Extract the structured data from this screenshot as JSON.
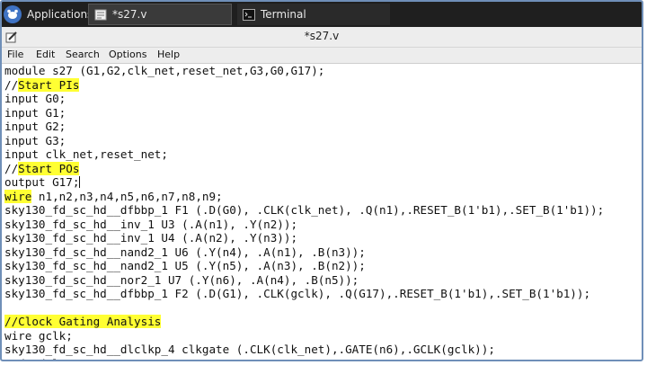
{
  "taskbar": {
    "applications_label": "Applications",
    "tasks": [
      {
        "label": "*s27.v"
      },
      {
        "label": "Terminal"
      }
    ]
  },
  "window": {
    "title": "*s27.v"
  },
  "menu": {
    "file": "File",
    "edit": "Edit",
    "search": "Search",
    "options": "Options",
    "help": "Help"
  },
  "editor": {
    "lines": [
      {
        "pre": "module s27 (G1,G2,clk_net,reset_net,G3,G0,G17);"
      },
      {
        "pre": "//",
        "hl": "Start PIs"
      },
      {
        "pre": "input G0;"
      },
      {
        "pre": "input G1;"
      },
      {
        "pre": "input G2;"
      },
      {
        "pre": "input G3;"
      },
      {
        "pre": "input clk_net,reset_net;"
      },
      {
        "pre": "//",
        "hl": "Start POs"
      },
      {
        "pre": "output G17;"
      },
      {
        "hl": "wire",
        "post": " n1,n2,n3,n4,n5,n6,n7,n8,n9;"
      },
      {
        "pre": "sky130_fd_sc_hd__dfbbp_1 F1 (.D(G0), .CLK(clk_net), .Q(n1),.RESET_B(1'b1),.SET_B(1'b1));"
      },
      {
        "pre": "sky130_fd_sc_hd__inv_1 U3 (.A(n1), .Y(n2));"
      },
      {
        "pre": "sky130_fd_sc_hd__inv_1 U4 (.A(n2), .Y(n3));"
      },
      {
        "pre": "sky130_fd_sc_hd__nand2_1 U6 (.Y(n4), .A(n1), .B(n3));"
      },
      {
        "pre": "sky130_fd_sc_hd__nand2_1 U5 (.Y(n5), .A(n3), .B(n2));"
      },
      {
        "pre": "sky130_fd_sc_hd__nor2_1 U7 (.Y(n6), .A(n4), .B(n5));"
      },
      {
        "pre": "sky130_fd_sc_hd__dfbbp_1 F2 (.D(G1), .CLK(gclk), .Q(G17),.RESET_B(1'b1),.SET_B(1'b1));"
      },
      {
        "pre": ""
      },
      {
        "hl": "//Clock Gating Analysis"
      },
      {
        "pre": "wire gclk;"
      },
      {
        "pre": "sky130_fd_sc_hd__dlclkp_4 clkgate (.CLK(clk_net),.GATE(n6),.GCLK(gclk));"
      },
      {
        "pre": "endmodule"
      }
    ]
  },
  "colors": {
    "highlight": "#ffff33",
    "taskbar_bg": "#1f1f1f",
    "frame_border": "#6f8fb8"
  }
}
